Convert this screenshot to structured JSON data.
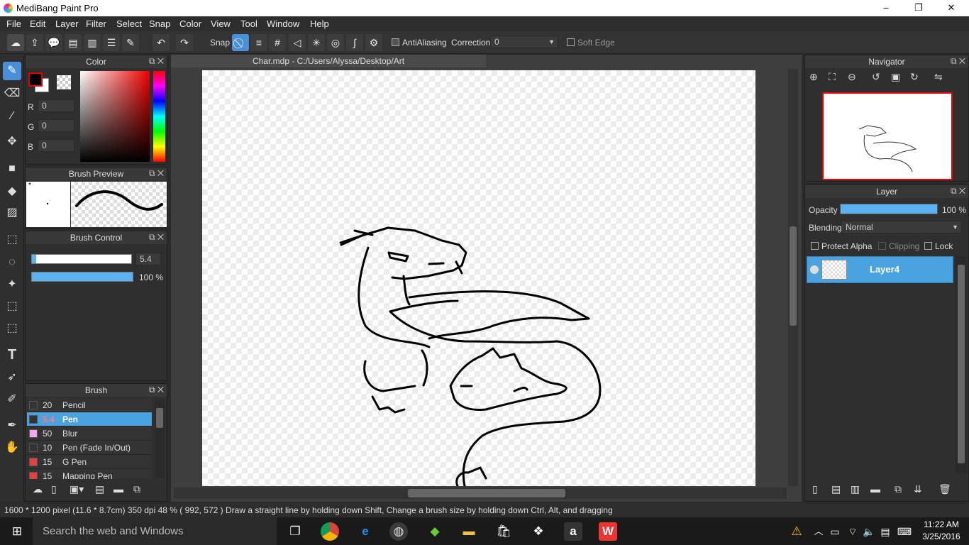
{
  "window": {
    "title": "MediBang Paint Pro",
    "minimize": "–",
    "maximize": "❐",
    "close": "✕"
  },
  "menu": [
    "File",
    "Edit",
    "Layer",
    "Filter",
    "Select",
    "Snap",
    "Color",
    "View",
    "Tool",
    "Window",
    "Help"
  ],
  "toolbar": {
    "snap_label": "Snap",
    "antialiasing_label": "AntiAliasing",
    "correction_label": "Correction",
    "correction_value": "0",
    "soft_edge_label": "Soft Edge"
  },
  "color_panel": {
    "title": "Color",
    "r_label": "R",
    "r_value": "0",
    "g_label": "G",
    "g_value": "0",
    "b_label": "B",
    "b_value": "0",
    "foreground": "#000000",
    "background": "#ffffff"
  },
  "brush_preview": {
    "title": "Brush Preview",
    "mark": "*"
  },
  "brush_control": {
    "title": "Brush Control",
    "size_value": "5.4",
    "size_fraction": 0.04,
    "opacity_value": "100 %",
    "opacity_fraction": 1.0
  },
  "brush_panel": {
    "title": "Brush",
    "items": [
      {
        "size": "20",
        "name": "Pencil",
        "color": "#333333"
      },
      {
        "size": "5.4",
        "name": "Pen",
        "color": "#333333",
        "selected": true
      },
      {
        "size": "50",
        "name": "Blur",
        "color": "#f4a8f0"
      },
      {
        "size": "10",
        "name": "Pen (Fade In/Out)",
        "color": "#333333"
      },
      {
        "size": "15",
        "name": "G Pen",
        "color": "#e84040"
      },
      {
        "size": "15",
        "name": "Mapping Pen",
        "color": "#e84040"
      }
    ]
  },
  "document": {
    "tab": "Char.mdp - C:/Users/Alyssa/Desktop/Art"
  },
  "navigator": {
    "title": "Navigator"
  },
  "layer_panel": {
    "title": "Layer",
    "opacity_label": "Opacity",
    "opacity_value": "100 %",
    "opacity_fraction": 1.0,
    "blending_label": "Blending",
    "blending_value": "Normal",
    "protect_alpha": "Protect Alpha",
    "clipping": "Clipping",
    "lock": "Lock",
    "layers": [
      {
        "name": "Layer4"
      }
    ]
  },
  "status": {
    "text": "1600 * 1200 pixel   (11.6 * 8.7cm)   350 dpi   48 %   ( 992, 572 )    Draw a straight line by holding down Shift, Change a brush size by holding down Ctrl, Alt, and dragging"
  },
  "taskbar": {
    "search_placeholder": "Search the web and Windows",
    "time": "11:22 AM",
    "date": "3/25/2016"
  },
  "colors": {
    "accent": "#4aa3df",
    "panel": "#2f2f2f",
    "canvas_bg": "#3e3e3e"
  }
}
